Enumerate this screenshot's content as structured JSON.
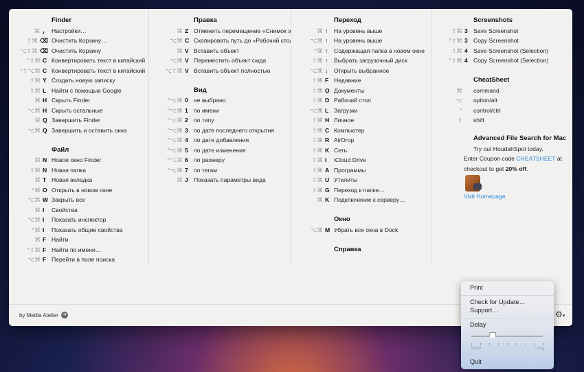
{
  "columns": [
    [
      {
        "title": "Finder",
        "rows": [
          [
            "⌘",
            "，",
            "Настройки…"
          ],
          [
            "⇧⌘",
            "⌫",
            "Очистить Корзину…"
          ],
          [
            "⌥⇧⌘",
            "⌫",
            "Очистить Корзину"
          ],
          [
            "^⇧⌘",
            "C",
            "Конвертировать текст в китайский"
          ],
          [
            "^⇧⌥⌘",
            "C",
            "Конвертировать текст в китайский"
          ],
          [
            "⇧⌘",
            "Y",
            "Создать новую записку"
          ],
          [
            "⇧⌘",
            "L",
            "Найти с помощью Google"
          ],
          [
            "⌘",
            "H",
            "Скрыть Finder"
          ],
          [
            "⌥⌘",
            "H",
            "Скрыть остальные"
          ],
          [
            "⌘",
            "Q",
            "Завершить Finder"
          ],
          [
            "⌥⌘",
            "Q",
            "Завершить и оставить окна"
          ]
        ]
      },
      {
        "title": "Файл",
        "rows": [
          [
            "⌘",
            "N",
            "Новое окно Finder"
          ],
          [
            "⇧⌘",
            "N",
            "Новая папка"
          ],
          [
            "⌘",
            "T",
            "Новая вкладка"
          ],
          [
            "^⌘",
            "O",
            "Открыть в новом окне"
          ],
          [
            "⌥⌘",
            "W",
            "Закрыть все"
          ],
          [
            "⌘",
            "I",
            "Свойства"
          ],
          [
            "⌥⌘",
            "I",
            "Показать инспектор"
          ],
          [
            "^⌘",
            "I",
            "Показать общие свойства"
          ],
          [
            "⌘",
            "F",
            "Найти"
          ],
          [
            "^⇧⌘",
            "F",
            "Найти по имени…"
          ],
          [
            "⌥⌘",
            "F",
            "Перейти в поле поиска"
          ]
        ]
      }
    ],
    [
      {
        "title": "Правка",
        "rows": [
          [
            "⌘",
            "Z",
            "Отменить перемещение «Снимок экрана»"
          ],
          [
            "⌥⌘",
            "C",
            "Скопировать путь до «Рабочий стол»"
          ],
          [
            "⌘",
            "V",
            "Вставить объект"
          ],
          [
            "⌥⌘",
            "V",
            "Переместить объект сюда"
          ],
          [
            "⌥⇧⌘",
            "V",
            "Вставить объект полностью"
          ]
        ]
      },
      {
        "title": "Вид",
        "rows": [
          [
            "^⌥⌘",
            "0",
            "не выбрано"
          ],
          [
            "^⌥⌘",
            "1",
            "по имени"
          ],
          [
            "^⌥⌘",
            "2",
            "по типу"
          ],
          [
            "^⌥⌘",
            "3",
            "по дате последнего открытия"
          ],
          [
            "^⌥⌘",
            "4",
            "по дате добавления"
          ],
          [
            "^⌥⌘",
            "5",
            "по дате изменения"
          ],
          [
            "^⌥⌘",
            "6",
            "по размеру"
          ],
          [
            "^⌥⌘",
            "7",
            "по тегам"
          ],
          [
            "⌘",
            "J",
            "Показать параметры вида"
          ]
        ]
      }
    ],
    [
      {
        "title": "Переход",
        "rows": [
          [
            "⌘",
            "↑",
            "На уровень выше"
          ],
          [
            "⌥⌘",
            "↑",
            "На уровень выше"
          ],
          [
            "^⌘",
            "↑",
            "Содержащая папка в новом окне"
          ],
          [
            "⇧⌘",
            "↑",
            "Выбрать загрузочный диск"
          ],
          [
            "⌥⌘",
            "↓",
            "Открыть выбранное"
          ],
          [
            "⇧⌘",
            "F",
            "Недавние"
          ],
          [
            "⇧⌘",
            "O",
            "Документы"
          ],
          [
            "⇧⌘",
            "D",
            "Рабочий стол"
          ],
          [
            "⌥⌘",
            "L",
            "Загрузки"
          ],
          [
            "⇧⌘",
            "H",
            "Личное"
          ],
          [
            "⇧⌘",
            "C",
            "Компьютер"
          ],
          [
            "⇧⌘",
            "R",
            "AirDrop"
          ],
          [
            "⇧⌘",
            "K",
            "Сеть"
          ],
          [
            "⇧⌘",
            "I",
            "iCloud Drive"
          ],
          [
            "⇧⌘",
            "A",
            "Программы"
          ],
          [
            "⇧⌘",
            "U",
            "Утилиты"
          ],
          [
            "⇧⌘",
            "G",
            "Переход к папке…"
          ],
          [
            "⌘",
            "K",
            "Подключение к серверу…"
          ]
        ]
      },
      {
        "title": "Окно",
        "rows": [
          [
            "⌥⌘",
            "M",
            "Убрать все окна в Dock"
          ]
        ]
      },
      {
        "title": "Справка",
        "rows": []
      }
    ],
    [
      {
        "title": "Screenshots",
        "rows": [
          [
            "⇧⌘",
            "3",
            "Save Screenshot"
          ],
          [
            "^⇧⌘",
            "3",
            "Copy Screenshot"
          ],
          [
            "⇧⌘",
            "4",
            "Save Screenshot (Selection)"
          ],
          [
            "^⇧⌘",
            "4",
            "Copy Screenshot (Selection)"
          ]
        ]
      },
      {
        "title": "CheatSheet",
        "rows": [
          [
            "⌘",
            "",
            "command"
          ],
          [
            "⌥",
            "",
            "option/alt"
          ],
          [
            "^",
            "",
            "control/ctrl"
          ],
          [
            "⇧",
            "",
            "shift"
          ]
        ]
      }
    ]
  ],
  "ad": {
    "title": "Advanced File Search for Mac",
    "line1": "Try out HoudahSpot today.",
    "line2a": "Enter Coupon code ",
    "coupon": "CHEATSHEET",
    "line2b": " at",
    "line3a": "checkout to get ",
    "discount": "20% off",
    "line3b": ".",
    "link": "Visit Homepage"
  },
  "footer": {
    "by": "by Media Atelier"
  },
  "menu": {
    "print": "Print",
    "update": "Check for Update…",
    "support": "Support…",
    "delay": "Delay",
    "short": "Short",
    "long": "Long",
    "quit": "Quit",
    "delay_value": 0.3,
    "ticks": 9
  }
}
